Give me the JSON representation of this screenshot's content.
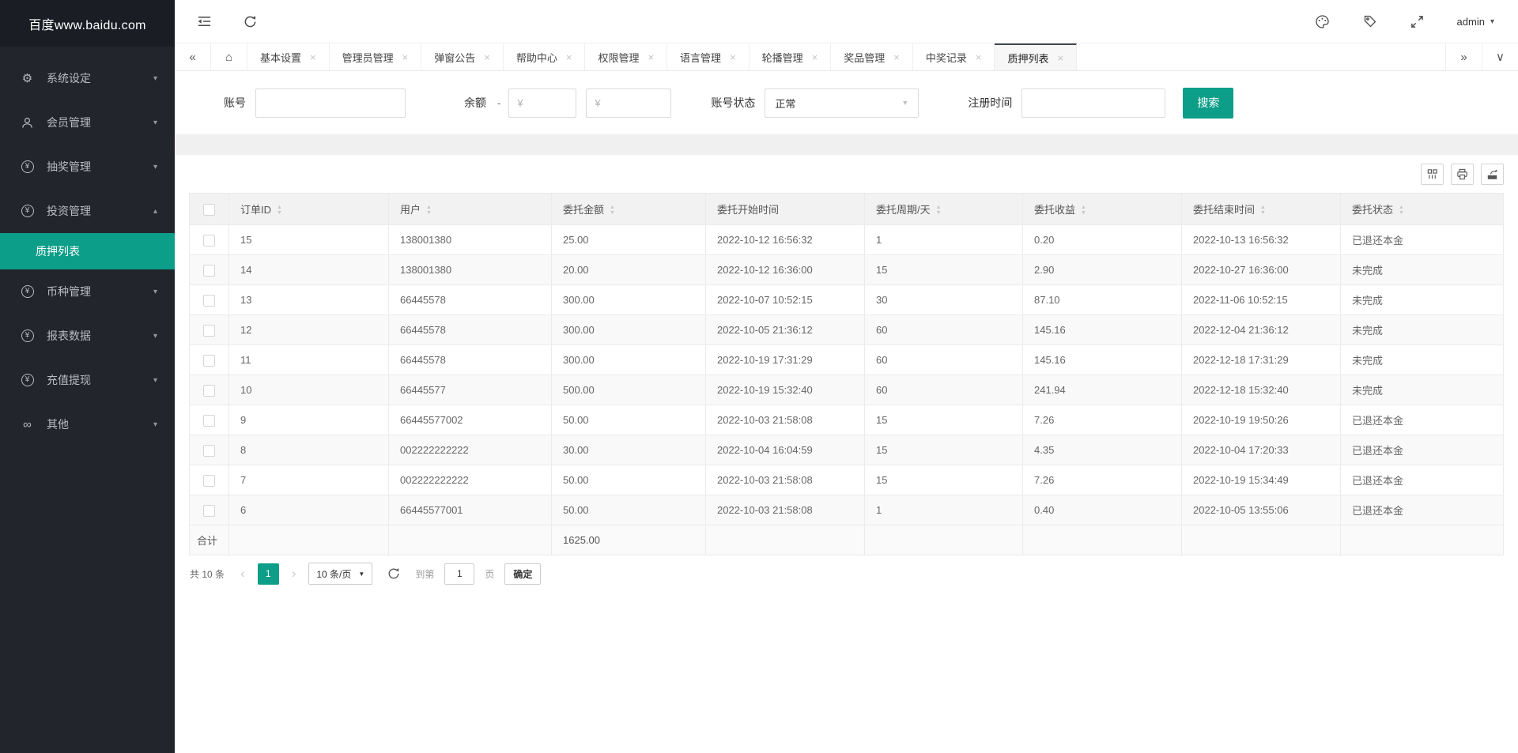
{
  "icons": {
    "caret_down": "▾",
    "caret_up": "▴",
    "yen": "¥",
    "infinity": "∞",
    "gear": "⚙",
    "home": "⌂",
    "tabs_prev": "«",
    "tabs_next": "»",
    "tab_menu": "∨",
    "close": "×",
    "sort_up": "▲",
    "sort_down": "▼",
    "select_caret": "▼",
    "page_prev": "‹",
    "page_next": "›"
  },
  "sidebar": {
    "title": "百度www.baidu.com",
    "items": [
      {
        "label": "系统设定"
      },
      {
        "label": "会员管理"
      },
      {
        "label": "抽奖管理"
      },
      {
        "label": "投资管理"
      },
      {
        "label": "币种管理"
      },
      {
        "label": "报表数据"
      },
      {
        "label": "充值提现"
      },
      {
        "label": "其他"
      }
    ],
    "submenu_active": "质押列表"
  },
  "topbar": {
    "username": "admin"
  },
  "tabs": {
    "items": [
      "基本设置",
      "管理员管理",
      "弹窗公告",
      "帮助中心",
      "权限管理",
      "语言管理",
      "轮播管理",
      "奖品管理",
      "中奖记录",
      "质押列表"
    ],
    "active": "质押列表"
  },
  "filters": {
    "account_label": "账号",
    "balance_label": "余额",
    "balance_dash": "-",
    "balance_min_placeholder": "¥",
    "balance_max_placeholder": "¥",
    "status_label": "账号状态",
    "status_value": "正常",
    "regtime_label": "注册时间",
    "search_label": "搜索"
  },
  "table": {
    "headers": [
      "订单ID",
      "用户",
      "委托金额",
      "委托开始时间",
      "委托周期/天",
      "委托收益",
      "委托结束时间",
      "委托状态"
    ],
    "rows": [
      {
        "id": "15",
        "user": "138001380",
        "amount": "25.00",
        "start": "2022-10-12 16:56:32",
        "cycle": "1",
        "profit": "0.20",
        "end": "2022-10-13 16:56:32",
        "status": "已退还本金"
      },
      {
        "id": "14",
        "user": "138001380",
        "amount": "20.00",
        "start": "2022-10-12 16:36:00",
        "cycle": "15",
        "profit": "2.90",
        "end": "2022-10-27 16:36:00",
        "status": "未完成"
      },
      {
        "id": "13",
        "user": "66445578",
        "amount": "300.00",
        "start": "2022-10-07 10:52:15",
        "cycle": "30",
        "profit": "87.10",
        "end": "2022-11-06 10:52:15",
        "status": "未完成"
      },
      {
        "id": "12",
        "user": "66445578",
        "amount": "300.00",
        "start": "2022-10-05 21:36:12",
        "cycle": "60",
        "profit": "145.16",
        "end": "2022-12-04 21:36:12",
        "status": "未完成"
      },
      {
        "id": "11",
        "user": "66445578",
        "amount": "300.00",
        "start": "2022-10-19 17:31:29",
        "cycle": "60",
        "profit": "145.16",
        "end": "2022-12-18 17:31:29",
        "status": "未完成"
      },
      {
        "id": "10",
        "user": "66445577",
        "amount": "500.00",
        "start": "2022-10-19 15:32:40",
        "cycle": "60",
        "profit": "241.94",
        "end": "2022-12-18 15:32:40",
        "status": "未完成"
      },
      {
        "id": "9",
        "user": "66445577002",
        "amount": "50.00",
        "start": "2022-10-03 21:58:08",
        "cycle": "15",
        "profit": "7.26",
        "end": "2022-10-19 19:50:26",
        "status": "已退还本金"
      },
      {
        "id": "8",
        "user": "002222222222",
        "amount": "30.00",
        "start": "2022-10-04 16:04:59",
        "cycle": "15",
        "profit": "4.35",
        "end": "2022-10-04 17:20:33",
        "status": "已退还本金"
      },
      {
        "id": "7",
        "user": "002222222222",
        "amount": "50.00",
        "start": "2022-10-03 21:58:08",
        "cycle": "15",
        "profit": "7.26",
        "end": "2022-10-19 15:34:49",
        "status": "已退还本金"
      },
      {
        "id": "6",
        "user": "66445577001",
        "amount": "50.00",
        "start": "2022-10-03 21:58:08",
        "cycle": "1",
        "profit": "0.40",
        "end": "2022-10-05 13:55:06",
        "status": "已退还本金"
      }
    ],
    "total_label": "合计",
    "total_amount": "1625.00"
  },
  "pagination": {
    "total": "共 10 条",
    "page": "1",
    "page_size": "10 条/页",
    "goto_label": "到第",
    "goto_value": "1",
    "goto_unit": "页",
    "confirm": "确定"
  }
}
